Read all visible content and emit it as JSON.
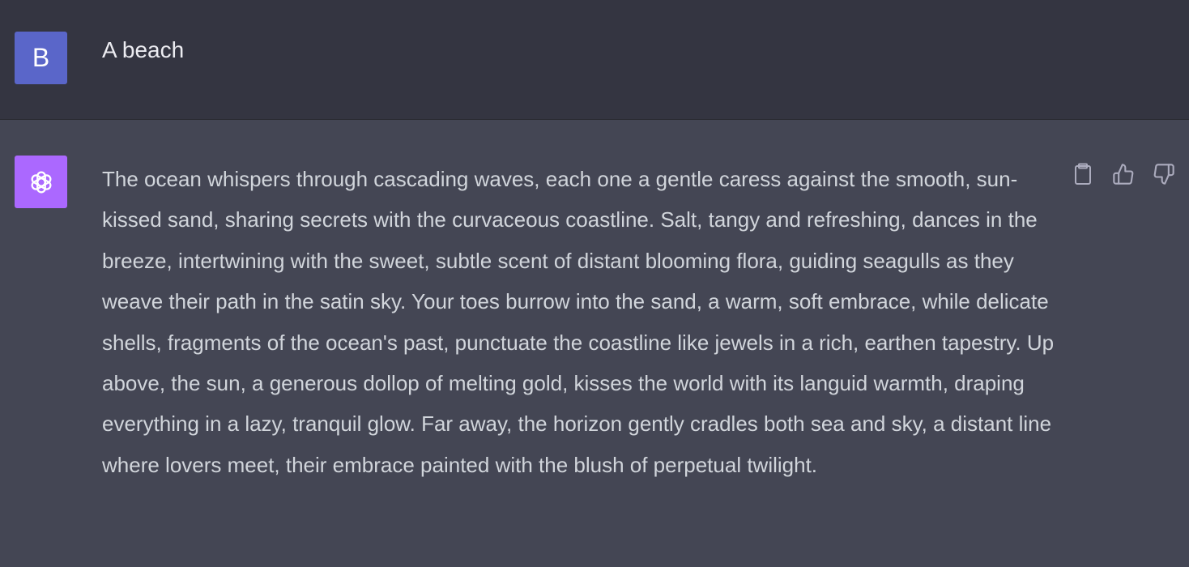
{
  "user_message": {
    "avatar_letter": "B",
    "text": "A beach"
  },
  "assistant_message": {
    "avatar_icon": "openai-logo-icon",
    "text": "The ocean whispers through cascading waves, each one a gentle caress against the smooth, sun-kissed sand, sharing secrets with the curvaceous coastline. Salt, tangy and refreshing, dances in the breeze, intertwining with the sweet, subtle scent of distant blooming flora, guiding seagulls as they weave their path in the satin sky. Your toes burrow into the sand, a warm, soft embrace, while delicate shells, fragments of the ocean's past, punctuate the coastline like jewels in a rich, earthen tapestry. Up above, the sun, a generous dollop of melting gold, kisses the world with its languid warmth, draping everything in a lazy, tranquil glow. Far away, the horizon gently cradles both sea and sky, a distant line where lovers meet, their embrace painted with the blush of perpetual twilight."
  },
  "actions": {
    "copy_icon": "clipboard-icon",
    "like_icon": "thumbs-up-icon",
    "dislike_icon": "thumbs-down-icon"
  },
  "colors": {
    "user_background": "#343541",
    "assistant_background": "#444654",
    "user_avatar": "#5a66c9",
    "assistant_avatar": "#ab68ff"
  }
}
